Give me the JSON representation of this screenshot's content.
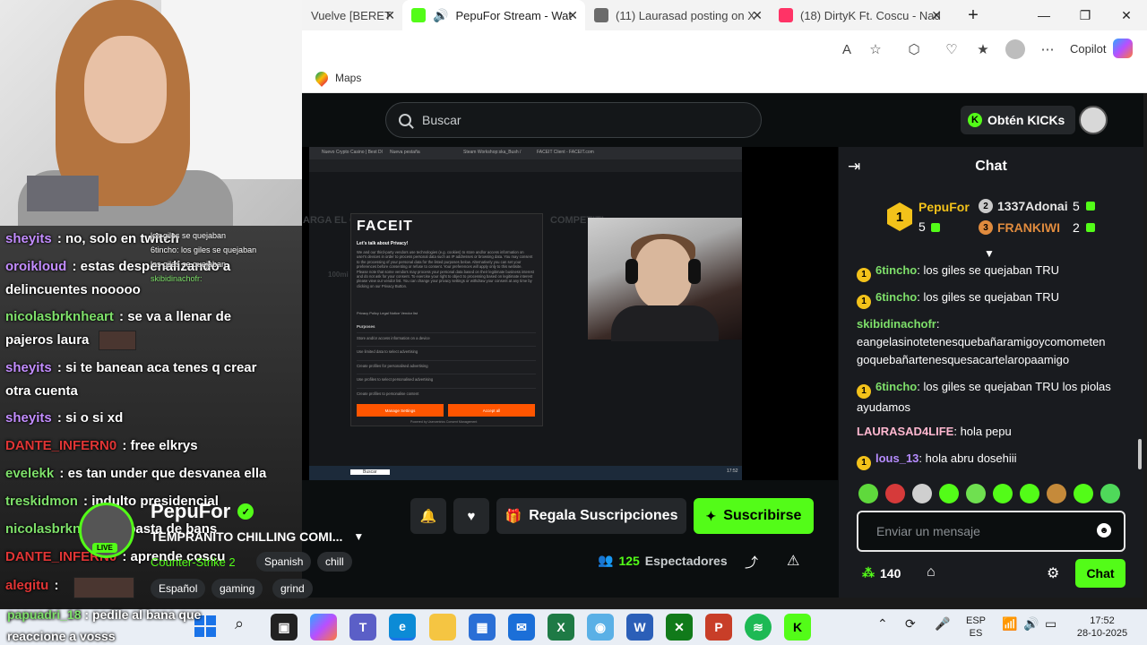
{
  "browser": {
    "tabs": [
      {
        "label": "Vuelve [BERET",
        "favicon_color": "#e9e9e9"
      },
      {
        "label": "PepuFor Stream - Wat",
        "favicon_color": "#53fc18"
      },
      {
        "label": "(11) Laurasad posting on X",
        "favicon_color": "#222222"
      },
      {
        "label": "(18) DirtyK Ft. Coscu - Nad",
        "favicon_color": "#ff3366"
      }
    ],
    "new_tab_icon": "+",
    "window_controls": {
      "minimize": "—",
      "restore": "❐",
      "close": "✕"
    },
    "copilot_label": "Copilot",
    "favorites": [
      {
        "label": "Maps"
      }
    ]
  },
  "kick": {
    "search_placeholder": "Buscar",
    "kicks_button": "Obtén KICKs",
    "kicks_icon": "K",
    "video": {
      "inner_tabs": [
        "Nuevo Crypto Casino | Best Dl",
        "Nueva pestaña",
        "Steam Workshop:ska_Bush /",
        "FACEIT Client - FACEIT.com"
      ],
      "ghost_texts": [
        "ARGA EL C",
        "COMPETITI",
        "100mi"
      ],
      "faceit": {
        "logo": "FACEIT",
        "title": "Let's talk about Privacy!",
        "body": "We and our third-party vendors use technologies (e.g. cookies) to store and/or access information on user's devices in order to process personal data such as IP addresses or browsing data. You may consent to the processing of your personal data for the listed purposes below. Alternatively you can set your preferences before consenting or refuse to consent. Your preferences will apply only to this website. Please note that some vendors may process your personal data based on their legitimate business interest and do not ask for your consent. To exercise your right to object to processing based on legitimate interest please view our vendor list. You can change your privacy settings or withdraw your consent at any time by clicking on our Privacy Button.",
        "links": "Privacy Policy    Legal Notice    Vendor list",
        "purposes_title": "Purposes",
        "purposes": [
          "Store and/or access information on a device",
          "Use limited data to select advertising",
          "Create profiles for personalised advertising",
          "Use profiles to select personalised advertising",
          "Create profiles to personalise content"
        ],
        "manage_button": "Manage Settings",
        "accept_button": "Accept all",
        "powered": "Powered by Usercentrics Consent Management"
      },
      "inner_taskbar_search": "Buscar",
      "inner_clock": "17:52"
    },
    "channel": {
      "name": "PepuFor",
      "live_badge": "LIVE",
      "title": "TEMPRANITO CHILLING COMI...",
      "game": "Counter-Strike 2",
      "tags": [
        "Spanish",
        "chill",
        "Español",
        "gaming",
        "grind"
      ]
    },
    "actions": {
      "gift_label": "Regala Suscripciones",
      "subscribe_label": "Suscribirse"
    },
    "viewers": {
      "count": "125",
      "label": "Espectadores"
    },
    "chat": {
      "title": "Chat",
      "leaderboard": [
        {
          "rank": "1",
          "name": "PepuFor",
          "count": "5",
          "color": "#f3c21a"
        },
        {
          "rank": "2",
          "name": "1337Adonai",
          "count": "5",
          "color": "#c9c9c9"
        },
        {
          "rank": "3",
          "name": "FRANKIWI",
          "count": "2",
          "color": "#e08b3e"
        }
      ],
      "messages": [
        {
          "user": "6tincho",
          "badge": "1",
          "color": "#7ee06a",
          "text": "los giles se quejaban TRU"
        },
        {
          "user": "6tincho",
          "badge": "1",
          "color": "#7ee06a",
          "text": "los giles se quejaban TRU"
        },
        {
          "user": "skibidinachofr",
          "badge": "",
          "color": "#7ee06a",
          "text": "eangelasinotetenesquebañaramigoycomometen goquebañartenesquesacartelaropaamigo"
        },
        {
          "user": "6tincho",
          "badge": "1",
          "color": "#7ee06a",
          "text": "los giles se quejaban TRU los piolas ayudamos"
        },
        {
          "user": "LAURASAD4LIFE",
          "badge": "",
          "color": "#ffb8d0",
          "text": "hola pepu"
        },
        {
          "user": "lous_13",
          "badge": "1",
          "color": "#b68cff",
          "text": "hola abru dosehiii"
        }
      ],
      "input_placeholder": "Enviar un mensaje",
      "points": "140",
      "send_label": "Chat"
    }
  },
  "overlay_chat": [
    {
      "user": "sheyits",
      "color": "#c38dff",
      "text": "no, solo en twitch"
    },
    {
      "user": "oroikloud",
      "color": "#c38dff",
      "text": "estas despenalizando a"
    },
    {
      "user": "",
      "color": "#ffffff",
      "text": "delincuentes nooooo"
    },
    {
      "user": "nicolasbrknheart",
      "color": "#7ee06a",
      "text": "se va a llenar de"
    },
    {
      "user": "",
      "color": "#ffffff",
      "text": "pajeros laura"
    },
    {
      "user": "sheyits",
      "color": "#c38dff",
      "text": "si te banean aca tenes q crear"
    },
    {
      "user": "",
      "color": "#ffffff",
      "text": "otra cuenta"
    },
    {
      "user": "sheyits",
      "color": "#c38dff",
      "text": "si o si xd"
    },
    {
      "user": "DANTE_INFERN0",
      "color": "#e03535",
      "text": "free elkrys"
    },
    {
      "user": "evelekk",
      "color": "#7ee06a",
      "text": "es tan under que desvanea ella"
    },
    {
      "user": "treskidmon",
      "color": "#7ee06a",
      "text": "indulto presidencial"
    },
    {
      "user": "nicolasbrknheart",
      "color": "#7ee06a",
      "text": "basta de bans"
    },
    {
      "user": "DANTE_INFERN0",
      "color": "#e03535",
      "text": "aprende coscu"
    },
    {
      "user": "alegitu",
      "color": "#e03535",
      "text": ""
    },
    {
      "user": "papuadri_18",
      "color": "#7ee06a",
      "text": "pedile al bana que"
    },
    {
      "user": "",
      "color": "#ffffff",
      "text": "reaccione a vosss"
    }
  ],
  "overlay_mini": [
    "los giles se quejaban",
    "6tincho: los giles se quejaban",
    "los giles se quejaban",
    "skibidinachofr:"
  ],
  "taskbar": {
    "lang_top": "ESP",
    "lang_bottom": "ES",
    "time": "17:52",
    "date": "28-10-2025",
    "apps": [
      "copilot-app",
      "teams-app",
      "edge-app",
      "files-app",
      "store-app",
      "mail-app",
      "excel-app",
      "photos-app",
      "word-app",
      "xbox-app",
      "powerpoint-app",
      "spotify-app",
      "kick-app"
    ]
  }
}
